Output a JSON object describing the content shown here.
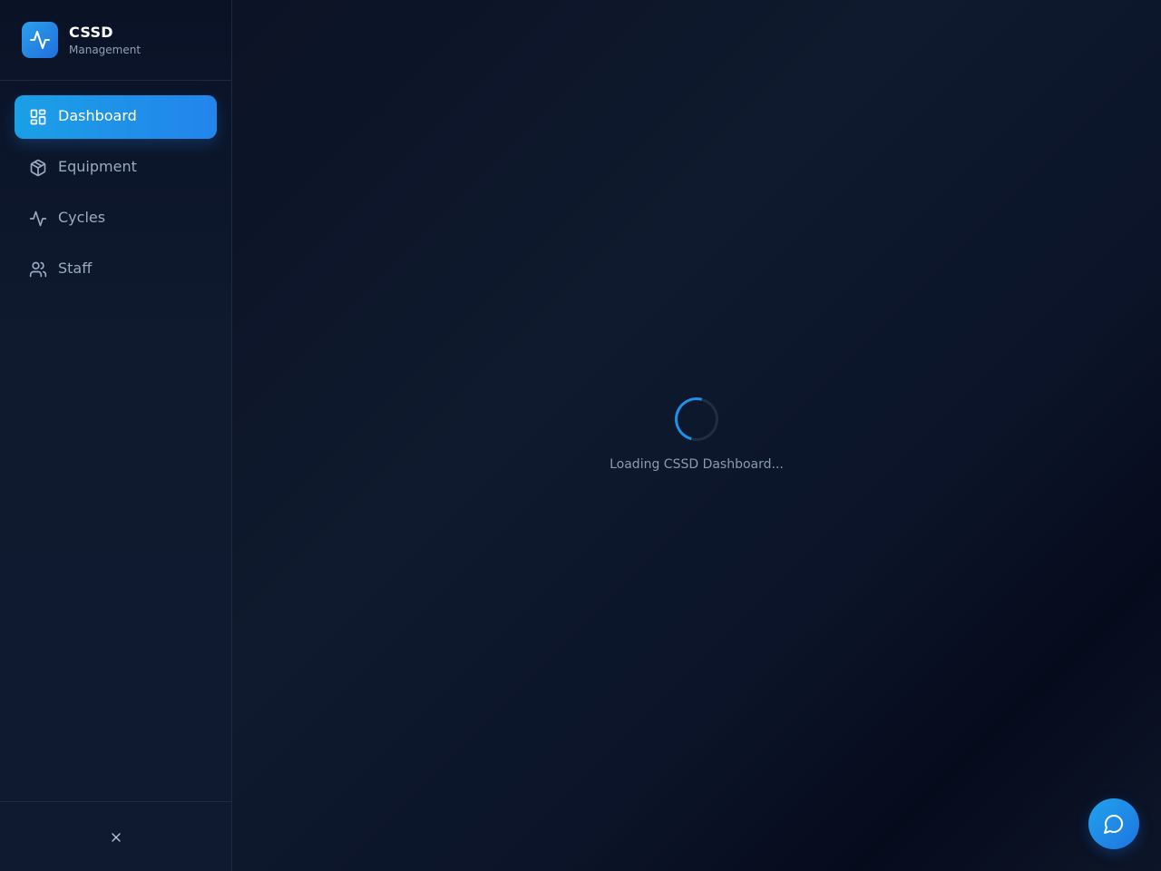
{
  "brand": {
    "title": "CSSD",
    "subtitle": "Management",
    "icon": "activity-icon"
  },
  "sidebar": {
    "items": [
      {
        "label": "Dashboard",
        "icon": "dashboard-grid-icon",
        "active": true
      },
      {
        "label": "Equipment",
        "icon": "package-icon",
        "active": false
      },
      {
        "label": "Cycles",
        "icon": "activity-icon",
        "active": false
      },
      {
        "label": "Staff",
        "icon": "users-icon",
        "active": false
      }
    ],
    "footer_icon": "close-icon"
  },
  "main": {
    "loading_text": "Loading CSSD Dashboard..."
  },
  "chat": {
    "icon": "chat-bubble-icon"
  },
  "colors": {
    "accent": "#1e90e8",
    "background": "#0b1224",
    "sidebar": "#0f1a2f",
    "text_muted": "#9aaac0"
  }
}
